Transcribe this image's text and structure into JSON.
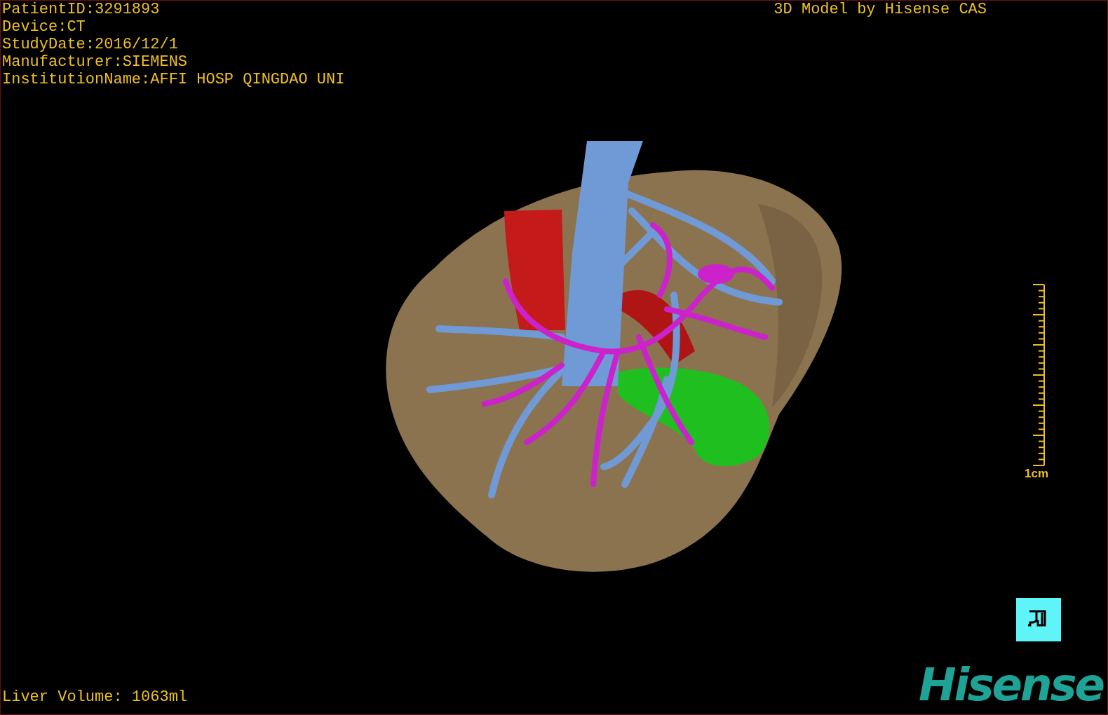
{
  "study_info": [
    "PatientID:3291893",
    "Device:CT",
    "StudyDate:2016/12/1",
    "Manufacturer:SIEMENS",
    "InstitutionName:AFFI HOSP QINGDAO UNI"
  ],
  "credit": "3D Model by Hisense CAS",
  "scale_bar": {
    "label": "1cm"
  },
  "liver_volume": "Liver Volume: 1063ml",
  "logo": "Hisense"
}
